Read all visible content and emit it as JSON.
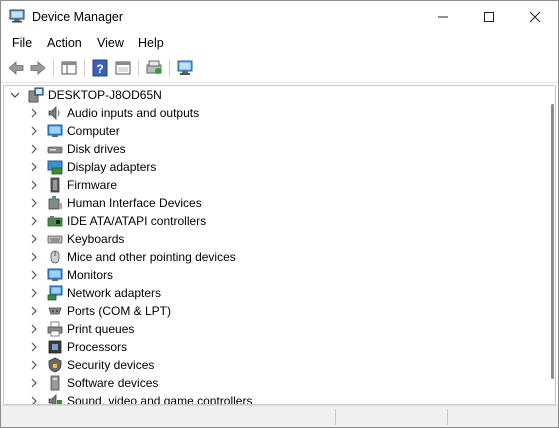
{
  "window": {
    "title": "Device Manager"
  },
  "menu": [
    "File",
    "Action",
    "View",
    "Help"
  ],
  "tree": {
    "root": "DESKTOP-J8OD65N",
    "categories": [
      "Audio inputs and outputs",
      "Computer",
      "Disk drives",
      "Display adapters",
      "Firmware",
      "Human Interface Devices",
      "IDE ATA/ATAPI controllers",
      "Keyboards",
      "Mice and other pointing devices",
      "Monitors",
      "Network adapters",
      "Ports (COM & LPT)",
      "Print queues",
      "Processors",
      "Security devices",
      "Software devices",
      "Sound, video and game controllers"
    ],
    "icons": [
      "speaker-icon",
      "computer-icon",
      "disk-drive-icon",
      "display-adapter-icon",
      "firmware-icon",
      "hid-icon",
      "ide-controller-icon",
      "keyboard-icon",
      "mouse-icon",
      "monitor-icon",
      "network-adapter-icon",
      "port-icon",
      "printer-icon",
      "processor-icon",
      "security-device-icon",
      "software-device-icon",
      "sound-controller-icon"
    ]
  },
  "colors": {
    "accent": "#2a7fd4",
    "chevron": "#555555"
  }
}
